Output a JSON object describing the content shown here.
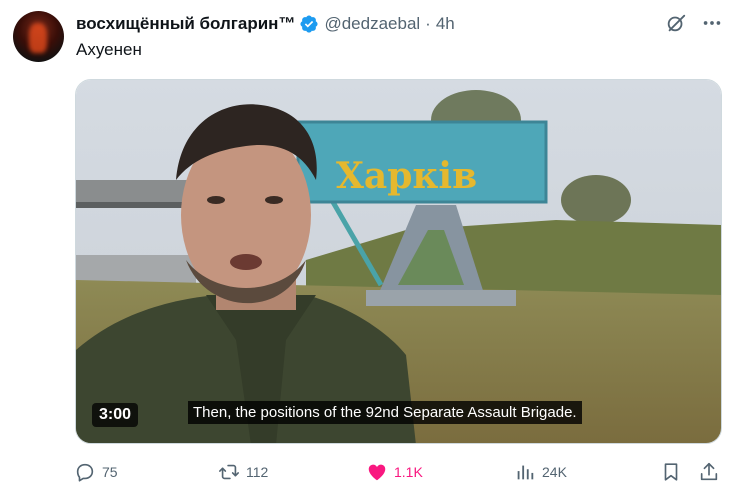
{
  "author": {
    "display_name": "восхищённый болгарин™",
    "handle": "@dedzaebal",
    "separator": "·",
    "time": "4h",
    "verified": true
  },
  "tweet": {
    "text": "Ахуенен"
  },
  "media": {
    "sign_text": "Харків",
    "duration": "3:00",
    "subtitle": "Then, the positions of the 92nd Separate Assault Brigade."
  },
  "actions": {
    "replies": "75",
    "retweets": "112",
    "likes": "1.1K",
    "views": "24K"
  },
  "colors": {
    "accent_like": "#f91880",
    "verified": "#1d9bf0",
    "secondary_text": "#536471"
  }
}
